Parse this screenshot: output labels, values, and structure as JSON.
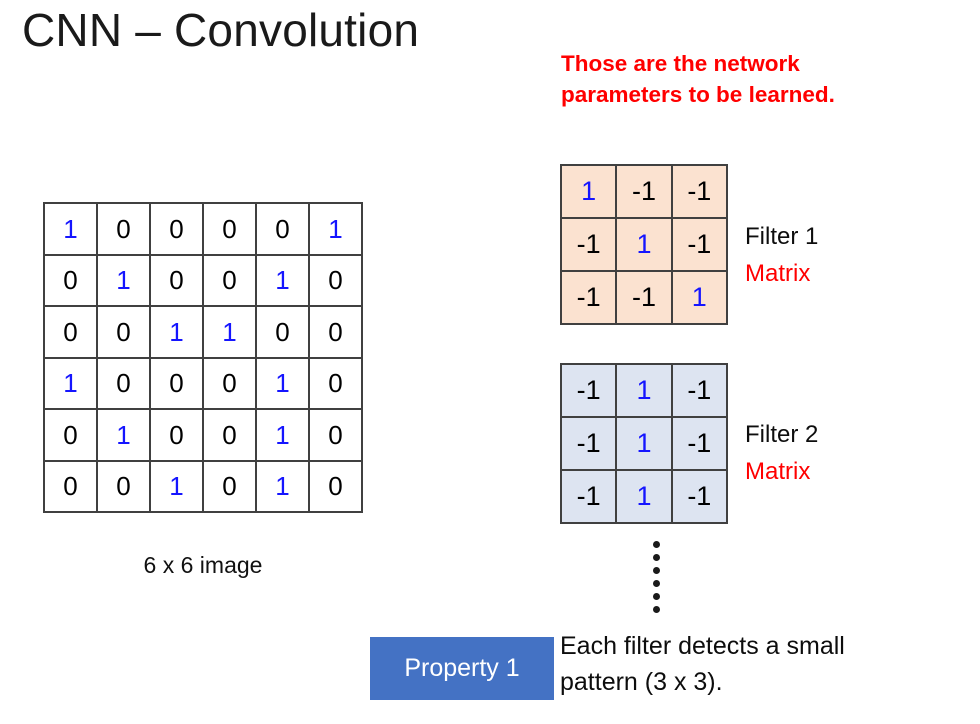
{
  "slide": {
    "title": "CNN – Convolution"
  },
  "network_params_note": {
    "lines": [
      "Those are the network",
      "parameters to be learned."
    ],
    "color": "#ff0000"
  },
  "input_image": {
    "caption": "6 x 6 image",
    "rows": [
      [
        "1",
        "0",
        "0",
        "0",
        "0",
        "1"
      ],
      [
        "0",
        "1",
        "0",
        "0",
        "1",
        "0"
      ],
      [
        "0",
        "0",
        "1",
        "1",
        "0",
        "0"
      ],
      [
        "1",
        "0",
        "0",
        "0",
        "1",
        "0"
      ],
      [
        "0",
        "1",
        "0",
        "0",
        "1",
        "0"
      ],
      [
        "0",
        "0",
        "1",
        "0",
        "1",
        "0"
      ]
    ],
    "one_color": "#1515ff",
    "zero_color": "#000000",
    "border_color": "#404040"
  },
  "filters": [
    {
      "name": "Filter 1",
      "kind": "Matrix",
      "background": "#fbe2d0",
      "rows": [
        [
          "1",
          "-1",
          "-1"
        ],
        [
          "-1",
          "1",
          "-1"
        ],
        [
          "-1",
          "-1",
          "1"
        ]
      ]
    },
    {
      "name": "Filter 2",
      "kind": "Matrix",
      "background": "#dde4f1",
      "rows": [
        [
          "-1",
          "1",
          "-1"
        ],
        [
          "-1",
          "1",
          "-1"
        ],
        [
          "-1",
          "1",
          "-1"
        ]
      ]
    }
  ],
  "ellipsis": {
    "dot_count": 6
  },
  "property": {
    "badge_label": "Property 1",
    "badge_color": "#4472c4",
    "description_lines": [
      "Each filter detects a small",
      "pattern (3 x 3)."
    ]
  }
}
